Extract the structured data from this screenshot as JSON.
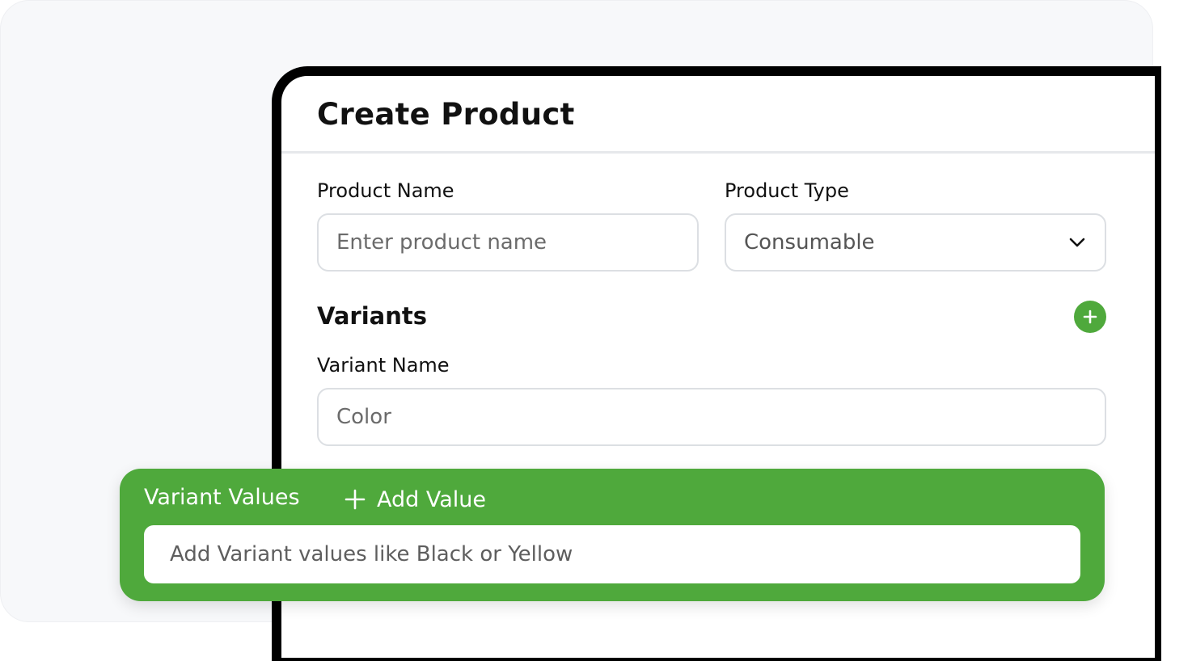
{
  "form": {
    "title": "Create Product",
    "product_name": {
      "label": "Product Name",
      "value": "",
      "placeholder": "Enter product name"
    },
    "product_type": {
      "label": "Product Type",
      "selected": "Consumable"
    },
    "variants": {
      "title": "Variants",
      "variant_name": {
        "label": "Variant Name",
        "value": "",
        "placeholder": "Color"
      }
    }
  },
  "variant_values": {
    "title": "Variant Values",
    "add_label": "Add Value",
    "input": {
      "value": "",
      "placeholder": "Add Variant values like Black or Yellow"
    }
  },
  "icons": {
    "dropdown": "chevron-down-icon",
    "add_variant": "plus-icon",
    "add_value": "plus-icon"
  },
  "colors": {
    "accent": "#4fa93c",
    "background": "#f7f8fa",
    "frame": "#000000"
  }
}
